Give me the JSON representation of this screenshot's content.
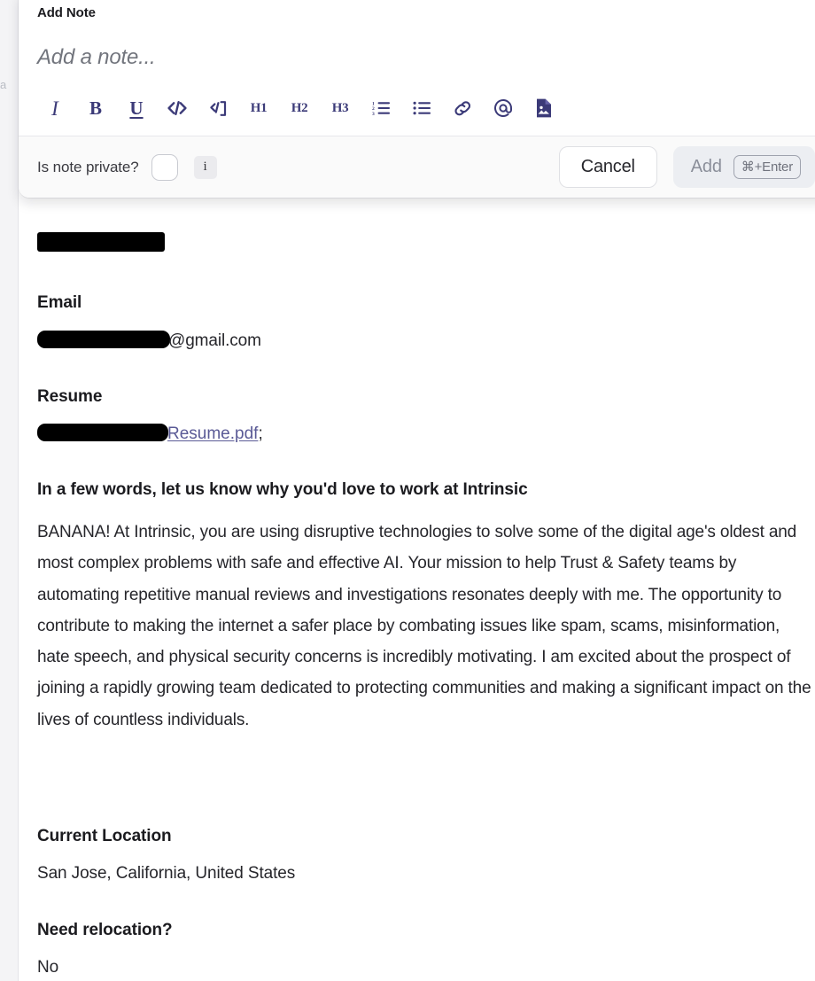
{
  "left_rail": {
    "clipped_text": "a\ni"
  },
  "note_panel": {
    "header_title": "Add Note",
    "editor_placeholder": "Add a note...",
    "toolbar": [
      {
        "name": "italic",
        "label": "I",
        "kind": "serif-italic"
      },
      {
        "name": "bold",
        "label": "B",
        "kind": "serif-bold"
      },
      {
        "name": "underline",
        "label": "U",
        "kind": "serif-underline"
      },
      {
        "name": "inline-code",
        "label": "</>",
        "kind": "svg"
      },
      {
        "name": "code-block",
        "label": "</]",
        "kind": "svg"
      },
      {
        "name": "heading-1",
        "label": "H1",
        "kind": "heading"
      },
      {
        "name": "heading-2",
        "label": "H2",
        "kind": "heading"
      },
      {
        "name": "heading-3",
        "label": "H3",
        "kind": "heading"
      },
      {
        "name": "ordered-list",
        "label": "",
        "kind": "svg"
      },
      {
        "name": "bullet-list",
        "label": "",
        "kind": "svg"
      },
      {
        "name": "link",
        "label": "",
        "kind": "svg"
      },
      {
        "name": "mention",
        "label": "@",
        "kind": "svg"
      },
      {
        "name": "attach-image",
        "label": "",
        "kind": "svg"
      }
    ],
    "footer": {
      "private_label": "Is note private?",
      "private_checked": false,
      "info_label": "i",
      "cancel_label": "Cancel",
      "add_label": "Add",
      "add_shortcut": "⌘+Enter",
      "add_disabled": true
    },
    "accent_color": "#3b3a78"
  },
  "profile": {
    "name_redacted": true,
    "email": {
      "label": "Email",
      "value_suffix": "@gmail.com",
      "redacted": true
    },
    "resume": {
      "label": "Resume",
      "link_text": "Resume.pdf",
      "trailing": ";",
      "link_color": "#5a5a96",
      "redacted": true
    },
    "question": {
      "label": "In a few words, let us know why you'd love to work at Intrinsic",
      "answer": "BANANA! At Intrinsic, you are using disruptive technologies to solve some of the digital age's oldest and most complex problems with safe and effective AI. Your mission to help Trust & Safety teams by automating repetitive manual reviews and investigations resonates deeply with me. The opportunity to contribute to making the internet a safer place by combating issues like spam, scams, misinformation, hate speech, and physical security concerns is incredibly motivating. I am excited about the prospect of joining a rapidly growing team dedicated to protecting communities and making a significant impact on the lives of countless individuals."
    },
    "current_location": {
      "label": "Current Location",
      "value": "San Jose, California, United States"
    },
    "need_relocation": {
      "label": "Need relocation?",
      "value": "No"
    }
  }
}
